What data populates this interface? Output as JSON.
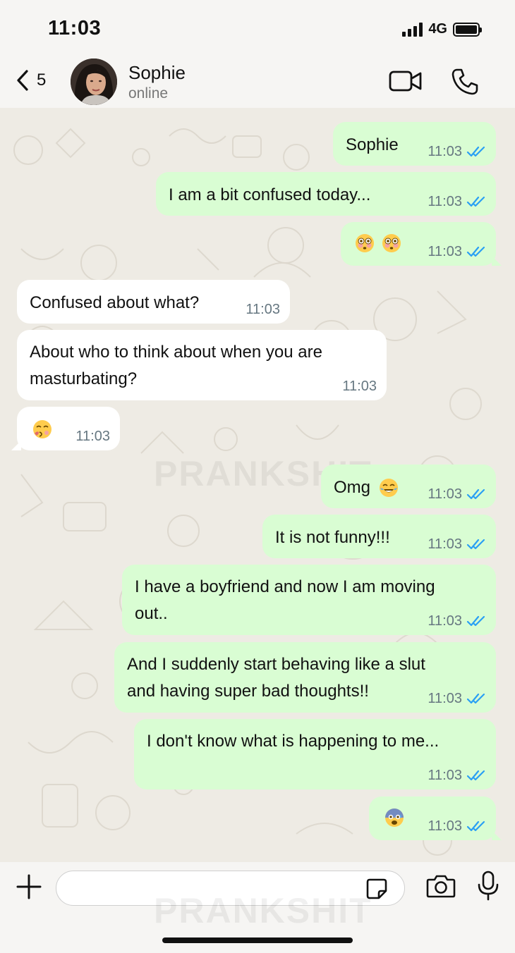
{
  "status_bar": {
    "time": "11:03",
    "network": "4G",
    "battery_level": 1.0
  },
  "header": {
    "back_count": "5",
    "contact_name": "Sophie",
    "contact_status": "online"
  },
  "watermark": "PRANKSHIT",
  "messages": [
    {
      "dir": "out",
      "text": "Sophie",
      "time": "11:03",
      "read": true
    },
    {
      "dir": "out",
      "text": "I am a bit confused today...",
      "time": "11:03",
      "read": true
    },
    {
      "dir": "out",
      "emoji": [
        "flushed-face",
        "flushed-face"
      ],
      "time": "11:03",
      "read": true
    },
    {
      "dir": "in",
      "text": "Confused about what?",
      "time": "11:03"
    },
    {
      "dir": "in",
      "text": [
        "About who to think about when you are",
        "masturbating?"
      ],
      "time": "11:03"
    },
    {
      "dir": "in",
      "emoji": [
        "face-blowing-kiss"
      ],
      "time": "11:03"
    },
    {
      "dir": "out",
      "text": "Omg",
      "emoji": [
        "face-with-tears-of-joy"
      ],
      "time": "11:03",
      "read": true
    },
    {
      "dir": "out",
      "text": "It is not funny!!!",
      "time": "11:03",
      "read": true
    },
    {
      "dir": "out",
      "text": [
        "I have a boyfriend and now I am moving",
        "out.."
      ],
      "time": "11:03",
      "read": true
    },
    {
      "dir": "out",
      "text": [
        "And I suddenly start behaving like a slut",
        "and having super bad thoughts!!"
      ],
      "time": "11:03",
      "read": true
    },
    {
      "dir": "out",
      "text": "I don't know what is happening to me...",
      "time": "11:03",
      "read": true
    },
    {
      "dir": "out",
      "emoji": [
        "anxious-face"
      ],
      "time": "11:03",
      "read": true
    }
  ],
  "input": {
    "value": "",
    "placeholder": ""
  },
  "colors": {
    "outgoing_bubble": "#d9fdd3",
    "incoming_bubble": "#ffffff",
    "read_ticks": "#2a9ff4",
    "chat_background": "#eeebe4"
  }
}
